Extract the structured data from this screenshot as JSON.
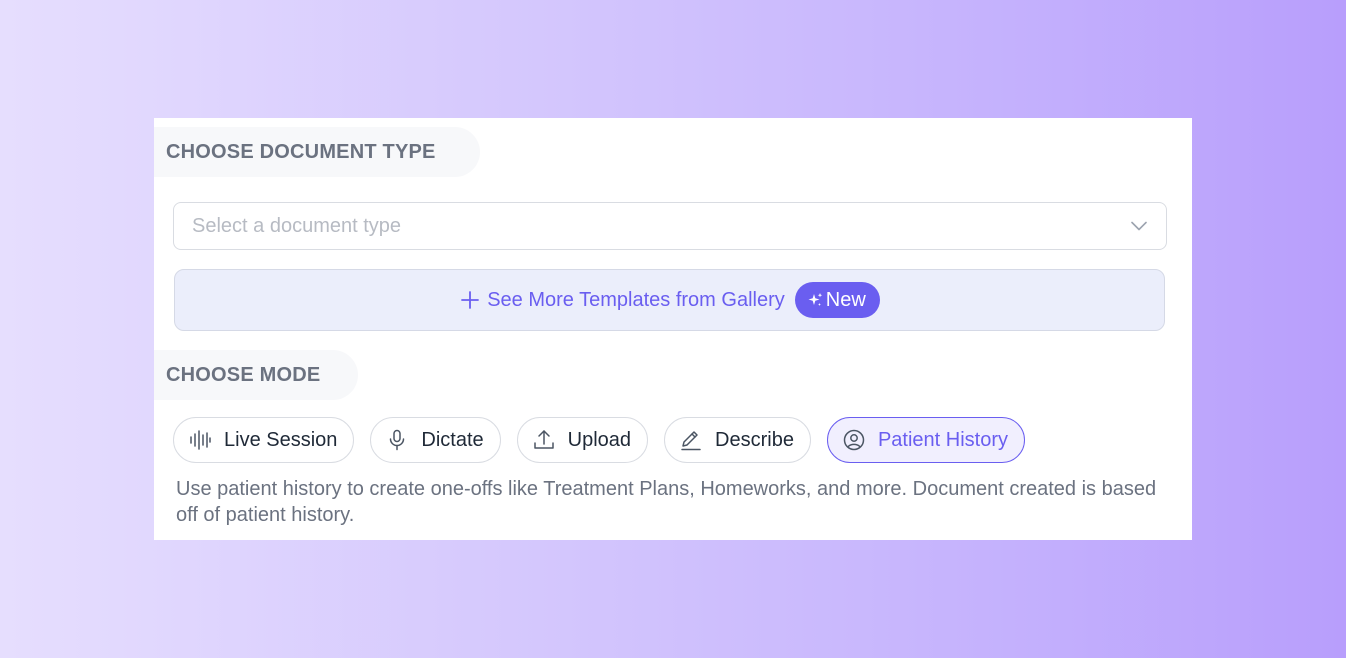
{
  "sections": {
    "document_type_title": "CHOOSE DOCUMENT TYPE",
    "mode_title": "CHOOSE MODE"
  },
  "document_select": {
    "placeholder": "Select a document type",
    "icon": "chevron-down-icon"
  },
  "gallery_button": {
    "label": "See More Templates from Gallery",
    "icon": "plus-icon",
    "badge": {
      "label": "New",
      "icon": "sparkle-icon"
    }
  },
  "modes": [
    {
      "label": "Live Session",
      "icon": "waveform-icon",
      "selected": false
    },
    {
      "label": "Dictate",
      "icon": "microphone-icon",
      "selected": false
    },
    {
      "label": "Upload",
      "icon": "upload-icon",
      "selected": false
    },
    {
      "label": "Describe",
      "icon": "pencil-icon",
      "selected": false
    },
    {
      "label": "Patient History",
      "icon": "user-circle-icon",
      "selected": true
    }
  ],
  "mode_description": "Use patient history to create one-offs like Treatment Plans, Homeworks, and more. Document created is based off of patient history.",
  "colors": {
    "accent": "#6a5ef0",
    "text_muted": "#6b7280",
    "border": "#d9dce2",
    "gallery_bg": "#ebeefb"
  }
}
